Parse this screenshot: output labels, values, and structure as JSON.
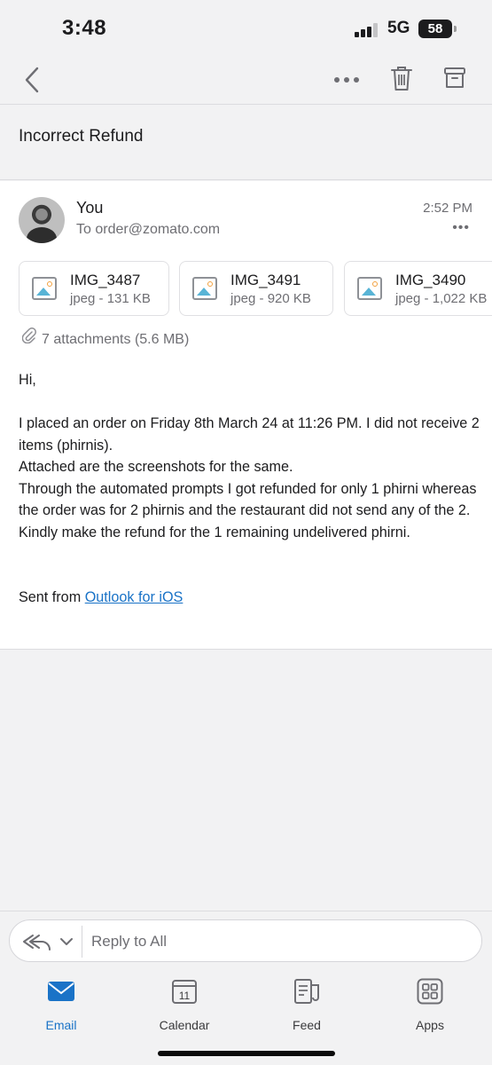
{
  "status_bar": {
    "time": "3:48",
    "network": "5G",
    "battery": "58"
  },
  "nav": {
    "back_icon": "chevron-left-icon",
    "more_icon": "more-horizontal-icon",
    "delete_icon": "trash-icon",
    "archive_icon": "archive-icon"
  },
  "subject": "Incorrect Refund",
  "message": {
    "sender": "You",
    "recipient": "To order@zomato.com",
    "time": "2:52 PM",
    "more": "•••",
    "attachments": [
      {
        "name": "IMG_3487",
        "meta": "jpeg - 131 KB"
      },
      {
        "name": "IMG_3491",
        "meta": "jpeg - 920 KB"
      },
      {
        "name": "IMG_3490",
        "meta": "jpeg - 1,022 KB"
      }
    ],
    "attachments_summary": "7 attachments (5.6 MB)",
    "body": {
      "greeting": "Hi,",
      "lines": [
        "I placed an order on Friday 8th March 24 at 11:26 PM. I did not receive 2 items (phirnis).",
        "Attached are the screenshots for the same.",
        "Through the automated prompts I got refunded for only 1 phirni whereas the order was for 2 phirnis and the restaurant did not send any of the 2.",
        "Kindly make the refund for the 1 remaining undelivered phirni."
      ],
      "signature_prefix": "Sent from",
      "signature_link": "Outlook for iOS"
    }
  },
  "reply": {
    "placeholder": "Reply to All",
    "icon": "reply-all-icon"
  },
  "tabs": [
    {
      "label": "Email",
      "icon": "email-icon",
      "active": true
    },
    {
      "label": "Calendar",
      "icon": "calendar-icon",
      "badge": "11"
    },
    {
      "label": "Feed",
      "icon": "feed-icon"
    },
    {
      "label": "Apps",
      "icon": "apps-icon"
    }
  ],
  "colors": {
    "accent": "#1a73c7",
    "background": "#f2f2f3",
    "card": "#ffffff",
    "secondary_text": "#6e6e73"
  }
}
